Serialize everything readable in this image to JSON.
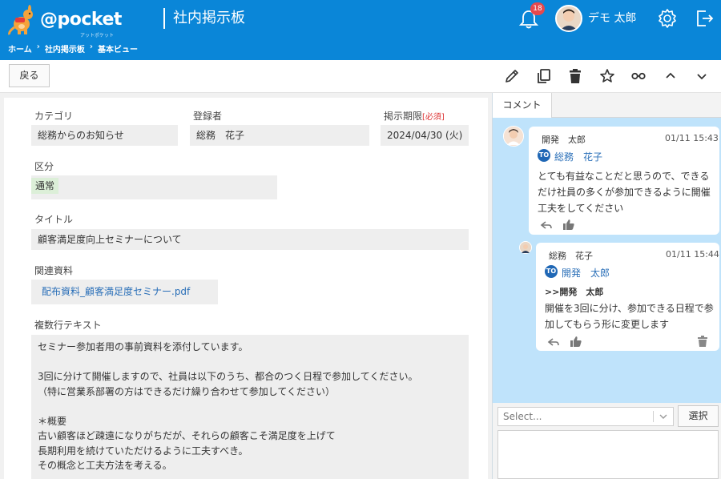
{
  "header": {
    "brand": "@pocket",
    "brand_sub": "アットポケット",
    "app_title": "社内掲示板",
    "notification_count": "18",
    "user_name": "デモ 太郎",
    "breadcrumb": [
      "ホーム",
      "社内掲示板",
      "基本ビュー"
    ],
    "colors": {
      "header_bg": "#0a86d8",
      "badge": "#e5484d"
    },
    "icons": [
      "bell-icon",
      "gear-icon",
      "logout-icon"
    ]
  },
  "toolbar": {
    "back_label": "戻る",
    "icons": [
      "edit-icon",
      "copy-icon",
      "trash-icon",
      "star-icon",
      "link-icon",
      "chevron-up-icon",
      "chevron-down-icon"
    ]
  },
  "record": {
    "category_label": "カテゴリ",
    "category_value": "総務からのお知らせ",
    "registrant_label": "登録者",
    "registrant_value": "総務　花子",
    "deadline_label": "掲示期限",
    "deadline_required": "[必須]",
    "deadline_value": "2024/04/30 (火)",
    "division_label": "区分",
    "division_value": "通常",
    "title_label": "タイトル",
    "title_value": "顧客満足度向上セミナーについて",
    "attachment_label": "関連資料",
    "attachment_value": "配布資料_顧客満足度セミナー.pdf",
    "multiline_label": "複数行テキスト",
    "multiline_value": "セミナー参加者用の事前資料を添付しています。\n\n3回に分けて開催しますので、社員は以下のうち、都合のつく日程で参加してください。\n（特に営業系部署の方はできるだけ繰り合わせて参加してください）\n\n＊概要\n古い顧客ほど疎遠になりがちだが、それらの顧客こそ満足度を上げて\n長期利用を続けていただけるように工夫すべき。\nその概念と工夫方法を考える。"
  },
  "comments": {
    "tab_label": "コメント",
    "items": [
      {
        "author": "開発　太郎",
        "time": "01/11 15:43",
        "to_badge": "TO",
        "to_name": "総務　花子",
        "text": "とても有益なことだと思うので、できる\nだけ社員の多くが参加できるように開催\n工夫をしてください"
      },
      {
        "author": "総務　花子",
        "time": "01/11 15:44",
        "to_badge": "TO",
        "to_name": "開発　太郎",
        "quote": ">>開発　太郎",
        "text": "開催を3回に分け、参加できる日程で参\n加してもらう形に変更します"
      }
    ],
    "select_placeholder": "Select...",
    "choose_label": "選択",
    "colors": {
      "feed_bg": "#bfe3fb",
      "to_chip": "#1f67b5"
    }
  }
}
